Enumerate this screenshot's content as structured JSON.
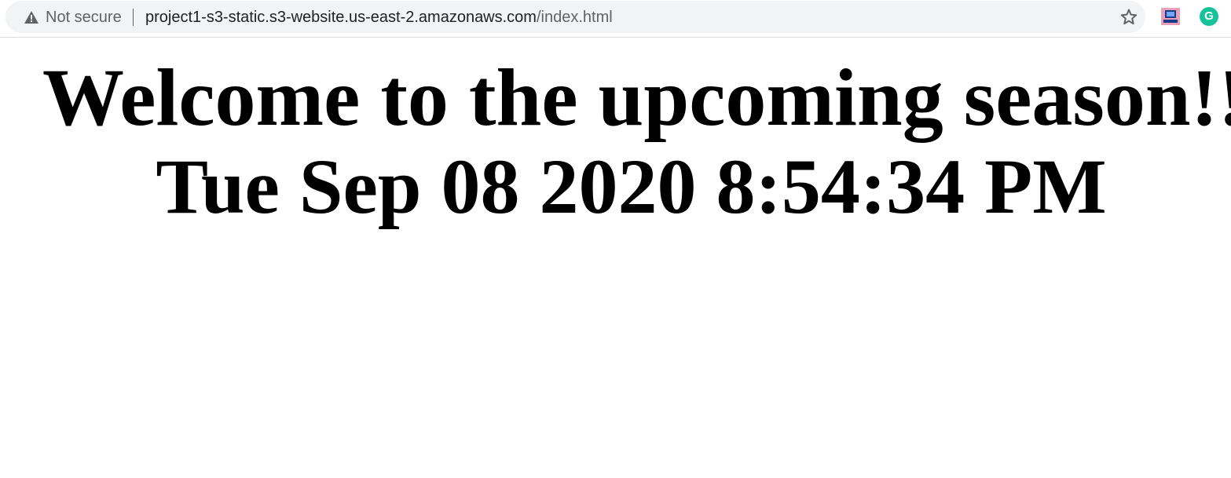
{
  "browser": {
    "security_label": "Not secure",
    "url_host": "project1-s3-static.s3-website.us-east-2.amazonaws.com",
    "url_path": "/index.html",
    "icons": [
      "warning-icon",
      "bookmark-star-icon",
      "extension-icon",
      "grammarly-icon"
    ],
    "grammarly_letter": "G",
    "grammarly_color": "#15c39a"
  },
  "page": {
    "welcome": "Welcome to the upcoming season!!",
    "datetime": "Tue Sep 08 2020 8:54:34 PM"
  }
}
